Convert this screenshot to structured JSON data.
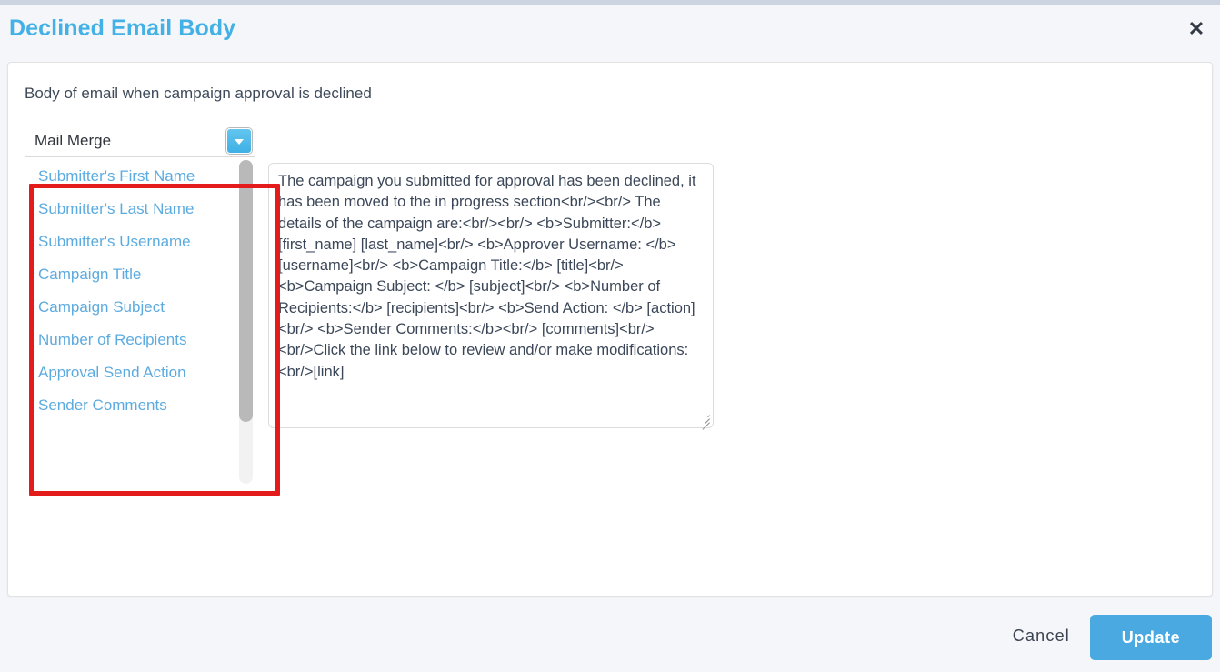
{
  "modal": {
    "title": "Declined Email Body",
    "close_icon": "close-icon",
    "field_label": "Body of email when campaign approval is declined"
  },
  "mail_merge": {
    "selected_label": "Mail Merge",
    "arrow_icon": "chevron-down-icon",
    "options": [
      "Submitter's First Name",
      "Submitter's Last Name",
      "Submitter's Username",
      "Campaign Title",
      "Campaign Subject",
      "Number of Recipients",
      "Approval Send Action",
      "Sender Comments"
    ]
  },
  "email_body": {
    "value": "The campaign you submitted for approval has been declined, it has been moved to the in progress section<br/><br/> The details of the campaign are:<br/><br/> <b>Submitter:</b> [first_name] [last_name]<br/> <b>Approver Username: </b> [username]<br/> <b>Campaign Title:</b> [title]<br/> <b>Campaign Subject: </b> [subject]<br/> <b>Number of Recipients:</b> [recipients]<br/> <b>Send Action: </b> [action]<br/> <b>Sender Comments:</b><br/> [comments]<br/> <br/>Click the link below to review and/or make modifications:<br/>[link]"
  },
  "footer": {
    "cancel_label": "Cancel",
    "update_label": "Update"
  },
  "colors": {
    "title_blue": "#43b0e6",
    "accent_blue": "#4aa9e0",
    "option_blue": "#5cabe0",
    "annotation_red": "#e41b1b",
    "page_bg": "#f4f6fa"
  }
}
